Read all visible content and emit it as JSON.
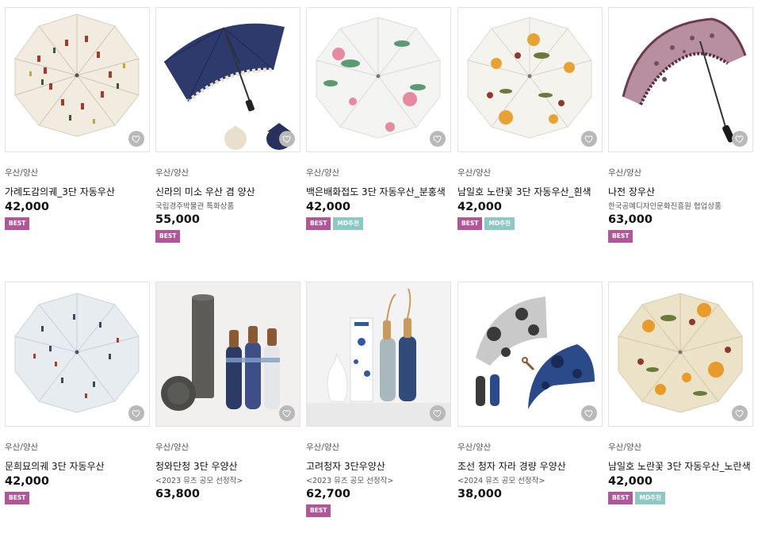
{
  "colors": {
    "best_badge": "#b2569a",
    "md_badge": "#8ec8c4",
    "wish_button": "#b9b9b9"
  },
  "products": [
    {
      "category": "우산/양산",
      "name": "가례도감의궤_3단 자동우산",
      "subtitle": "",
      "price": "42,000",
      "badges": [
        "BEST"
      ]
    },
    {
      "category": "우산/양산",
      "name": "신라의 미소 우산 겸 양산",
      "subtitle": "국립경주박물관 특화상품",
      "price": "55,000",
      "badges": [
        "BEST"
      ]
    },
    {
      "category": "우산/양산",
      "name": "백은배화접도 3단 자동우산_분홍색",
      "subtitle": "",
      "price": "42,000",
      "badges": [
        "BEST",
        "MD추천"
      ]
    },
    {
      "category": "우산/양산",
      "name": "남일호 노란꽃 3단 자동우산_흰색",
      "subtitle": "",
      "price": "42,000",
      "badges": [
        "BEST",
        "MD추천"
      ]
    },
    {
      "category": "우산/양산",
      "name": "나전 장우산",
      "subtitle": "한국공예디자인문화진흥원 협업상품",
      "price": "63,000",
      "badges": [
        "BEST"
      ]
    },
    {
      "category": "우산/양산",
      "name": "문희묘의궤 3단 자동우산",
      "subtitle": "",
      "price": "42,000",
      "badges": [
        "BEST"
      ]
    },
    {
      "category": "우산/양산",
      "name": "청와단청 3단 우양산",
      "subtitle": "<2023 뮤즈 공모 선정작>",
      "price": "63,800",
      "badges": []
    },
    {
      "category": "우산/양산",
      "name": "고려청자 3단우양산",
      "subtitle": "<2023 뮤즈 공모 선정작>",
      "price": "62,700",
      "badges": [
        "BEST"
      ]
    },
    {
      "category": "우산/양산",
      "name": "조선 청자 자라 경량 우양산",
      "subtitle": "<2024 뮤즈 공모 선정작>",
      "price": "38,000",
      "badges": []
    },
    {
      "category": "우산/양산",
      "name": "남일호 노란꽃 3단 자동우산_노란색",
      "subtitle": "",
      "price": "42,000",
      "badges": [
        "BEST",
        "MD추천"
      ]
    }
  ]
}
